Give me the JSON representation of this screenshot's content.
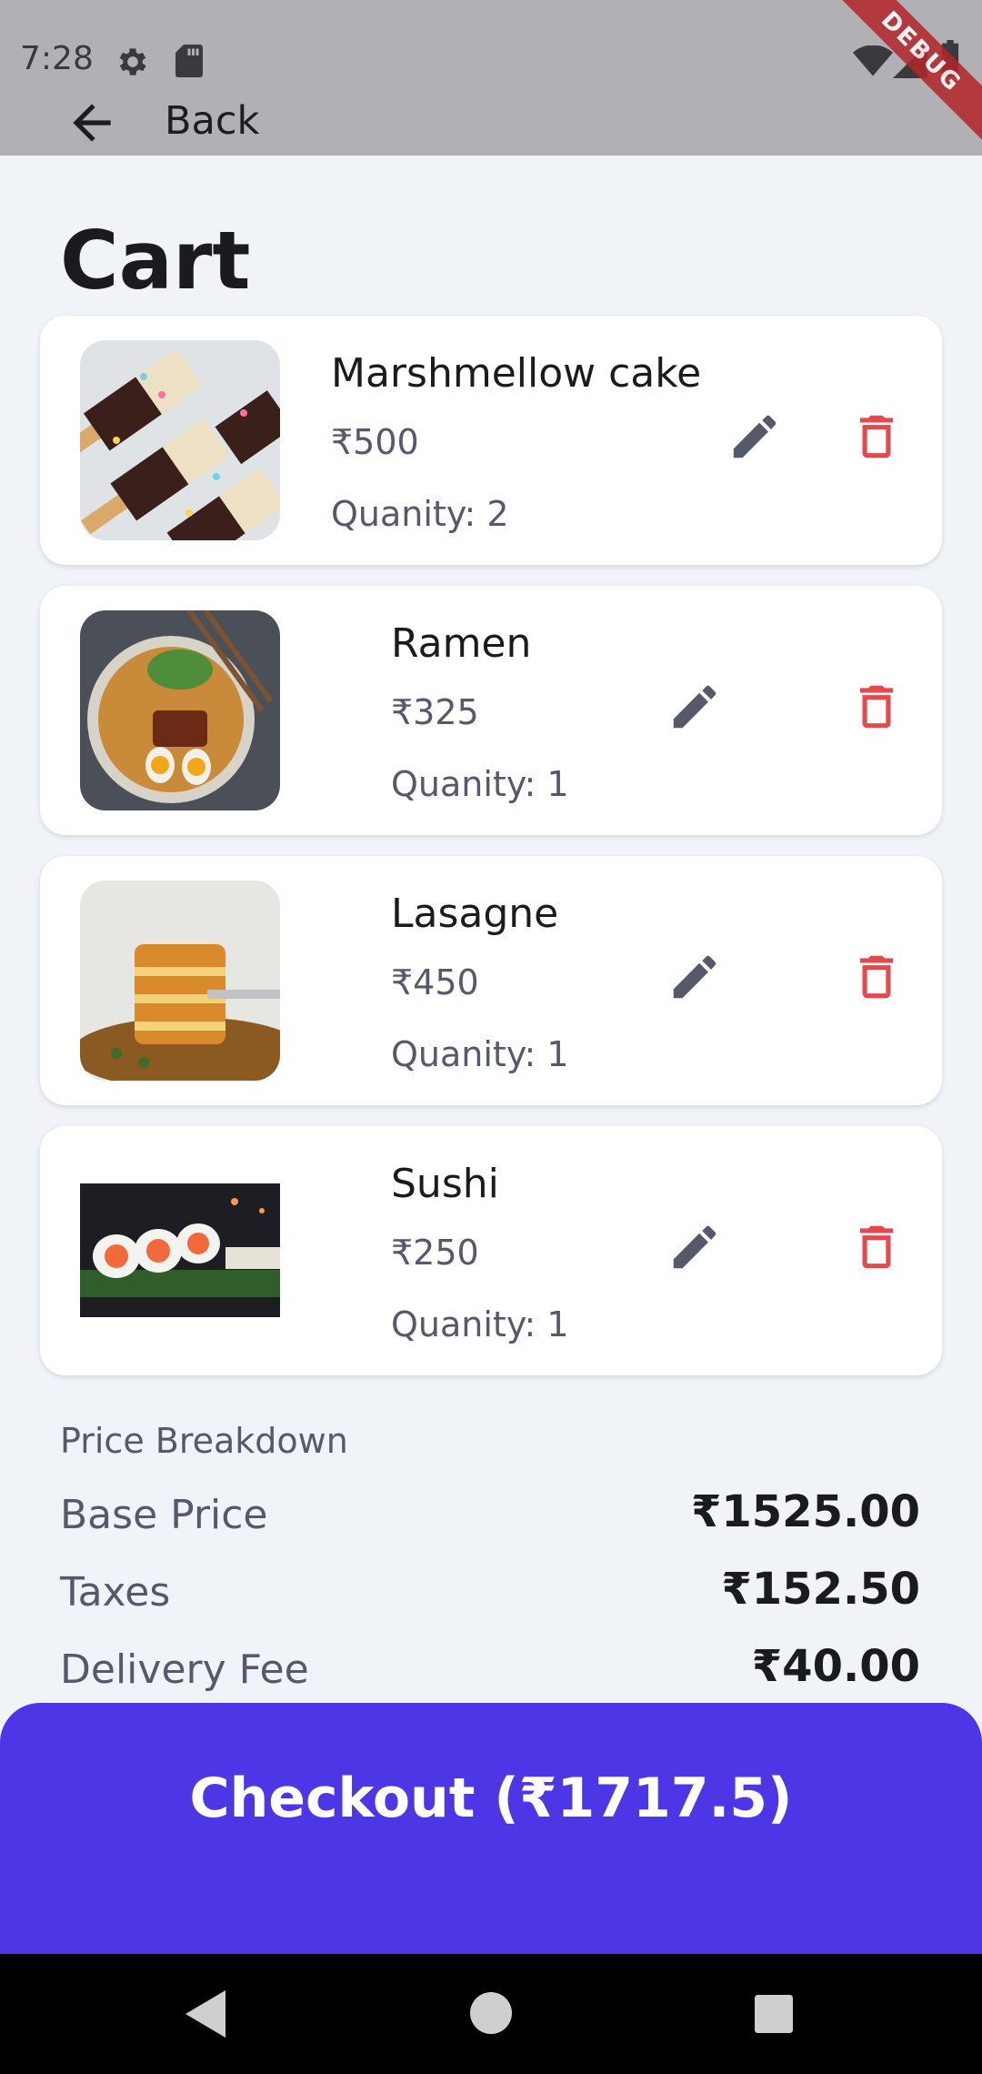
{
  "status_bar": {
    "time": "7:28",
    "debug_banner": "DEBUG"
  },
  "app_bar": {
    "back_label": "Back"
  },
  "page": {
    "title": "Cart"
  },
  "cart": {
    "items": [
      {
        "name": "Marshmellow cake",
        "price": "₹500",
        "quantity": "Quanity: 2"
      },
      {
        "name": "Ramen",
        "price": "₹325",
        "quantity": "Quanity: 1"
      },
      {
        "name": "Lasagne",
        "price": "₹450",
        "quantity": "Quanity: 1"
      },
      {
        "name": "Sushi",
        "price": "₹250",
        "quantity": "Quanity: 1"
      }
    ]
  },
  "breakdown": {
    "title": "Price Breakdown",
    "rows": [
      {
        "label": "Base Price",
        "value": "₹1525.00"
      },
      {
        "label": "Taxes",
        "value": "₹152.50"
      },
      {
        "label": "Delivery Fee",
        "value": "₹40.00"
      }
    ]
  },
  "checkout": {
    "label": "Checkout (₹1717.5)"
  },
  "colors": {
    "accent": "#4d36e6",
    "delete": "#e5484d",
    "edit": "#55596a",
    "background": "#f0f3f8"
  },
  "icons": {
    "status": [
      "settings-icon",
      "sd-card-icon",
      "wifi-icon",
      "signal-icon",
      "battery-icon"
    ],
    "item_actions": [
      "edit-icon",
      "delete-icon"
    ],
    "nav": [
      "nav-back-icon",
      "nav-home-icon",
      "nav-recents-icon"
    ]
  }
}
